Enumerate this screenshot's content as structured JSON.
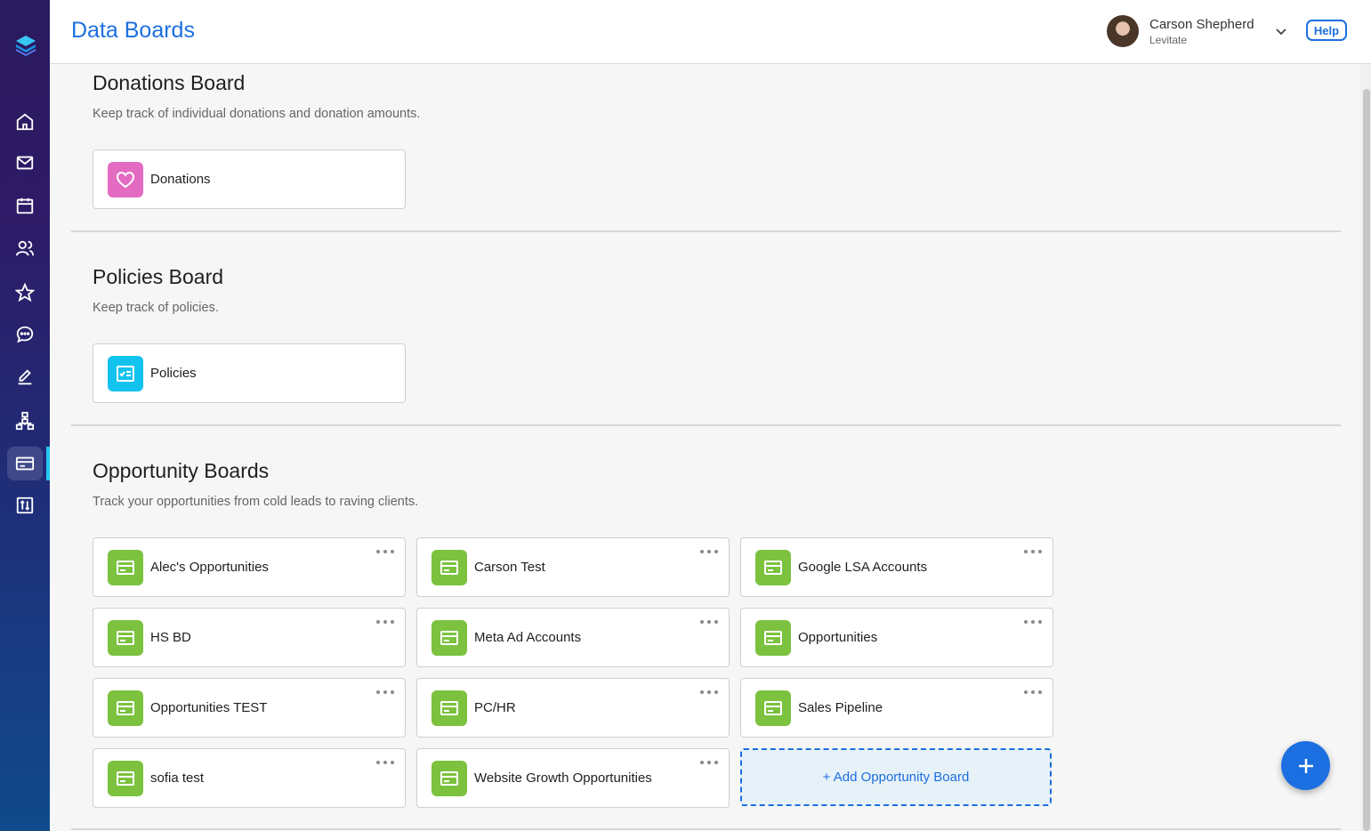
{
  "header": {
    "title": "Data Boards",
    "user_name": "Carson Shepherd",
    "user_org": "Levitate",
    "help_label": "Help"
  },
  "sidebar": {
    "items": [
      {
        "name": "home-icon"
      },
      {
        "name": "mail-icon"
      },
      {
        "name": "calendar-icon"
      },
      {
        "name": "people-icon"
      },
      {
        "name": "star-icon"
      },
      {
        "name": "chat-icon"
      },
      {
        "name": "edit-icon"
      },
      {
        "name": "org-chart-icon"
      },
      {
        "name": "boards-icon",
        "active": true
      },
      {
        "name": "transfer-icon"
      }
    ]
  },
  "sections": {
    "donations": {
      "title": "Donations Board",
      "description": "Keep track of individual donations and donation amounts.",
      "cards": [
        {
          "label": "Donations",
          "icon": "heart-icon",
          "color": "#e36bc2"
        }
      ]
    },
    "policies": {
      "title": "Policies Board",
      "description": "Keep track of policies.",
      "cards": [
        {
          "label": "Policies",
          "icon": "checklist-icon",
          "color": "#12c3ef"
        }
      ]
    },
    "opportunities": {
      "title": "Opportunity Boards",
      "description": "Track your opportunities from cold leads to raving clients.",
      "cards": [
        {
          "label": "Alec's Opportunities"
        },
        {
          "label": "Carson Test"
        },
        {
          "label": "Google LSA Accounts"
        },
        {
          "label": "HS BD"
        },
        {
          "label": "Meta Ad Accounts"
        },
        {
          "label": "Opportunities"
        },
        {
          "label": "Opportunities TEST"
        },
        {
          "label": "PC/HR"
        },
        {
          "label": "Sales Pipeline"
        },
        {
          "label": "sofia test"
        },
        {
          "label": "Website Growth Opportunities"
        }
      ],
      "card_icon": "card-icon",
      "card_color": "#7cc23f",
      "add_label": "+ Add Opportunity Board"
    }
  },
  "colors": {
    "accent": "#1c6fe0",
    "sidebar_active": "#22c7f0"
  }
}
